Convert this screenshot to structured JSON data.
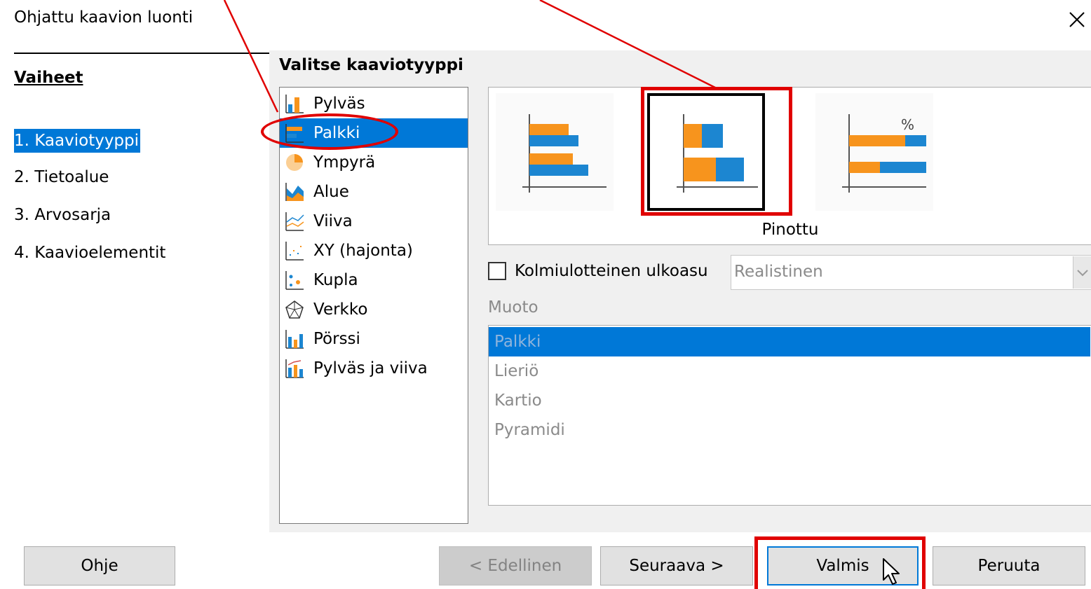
{
  "window": {
    "title": "Ohjattu kaavion luonti",
    "close_symbol": "✕"
  },
  "steps": {
    "heading": "Vaiheet",
    "items": [
      {
        "label": "1. Kaaviotyyppi",
        "active": true
      },
      {
        "label": "2. Tietoalue",
        "active": false
      },
      {
        "label": "3. Arvosarja",
        "active": false
      },
      {
        "label": "4. Kaavioelementit",
        "active": false
      }
    ]
  },
  "chart_type": {
    "heading": "Valitse kaaviotyyppi",
    "types": [
      {
        "label": "Pylväs",
        "icon": "column-chart-icon",
        "selected": false
      },
      {
        "label": "Palkki",
        "icon": "bar-chart-icon",
        "selected": true
      },
      {
        "label": "Ympyrä",
        "icon": "pie-chart-icon",
        "selected": false
      },
      {
        "label": "Alue",
        "icon": "area-chart-icon",
        "selected": false
      },
      {
        "label": "Viiva",
        "icon": "line-chart-icon",
        "selected": false
      },
      {
        "label": "XY (hajonta)",
        "icon": "scatter-chart-icon",
        "selected": false
      },
      {
        "label": "Kupla",
        "icon": "bubble-chart-icon",
        "selected": false
      },
      {
        "label": "Verkko",
        "icon": "net-chart-icon",
        "selected": false
      },
      {
        "label": "Pörssi",
        "icon": "stock-chart-icon",
        "selected": false
      },
      {
        "label": "Pylväs ja viiva",
        "icon": "column-line-chart-icon",
        "selected": false
      }
    ],
    "variant_caption": "Pinottu",
    "percent_symbol": "%"
  },
  "three_d": {
    "checkbox_label": "Kolmiulotteinen ulkoasu",
    "checked": false,
    "select_value": "Realistinen"
  },
  "shape": {
    "label": "Muoto",
    "items": [
      {
        "label": "Palkki",
        "selected": true
      },
      {
        "label": "Lieriö",
        "selected": false
      },
      {
        "label": "Kartio",
        "selected": false
      },
      {
        "label": "Pyramidi",
        "selected": false
      }
    ]
  },
  "buttons": {
    "help": "Ohje",
    "back": "< Edellinen",
    "next": "Seuraava >",
    "finish": "Valmis",
    "cancel": "Peruuta"
  },
  "colors": {
    "selection": "#0078d7",
    "accent_orange": "#f7941d",
    "accent_blue": "#1c86d1",
    "annotation_red": "#e00000"
  }
}
